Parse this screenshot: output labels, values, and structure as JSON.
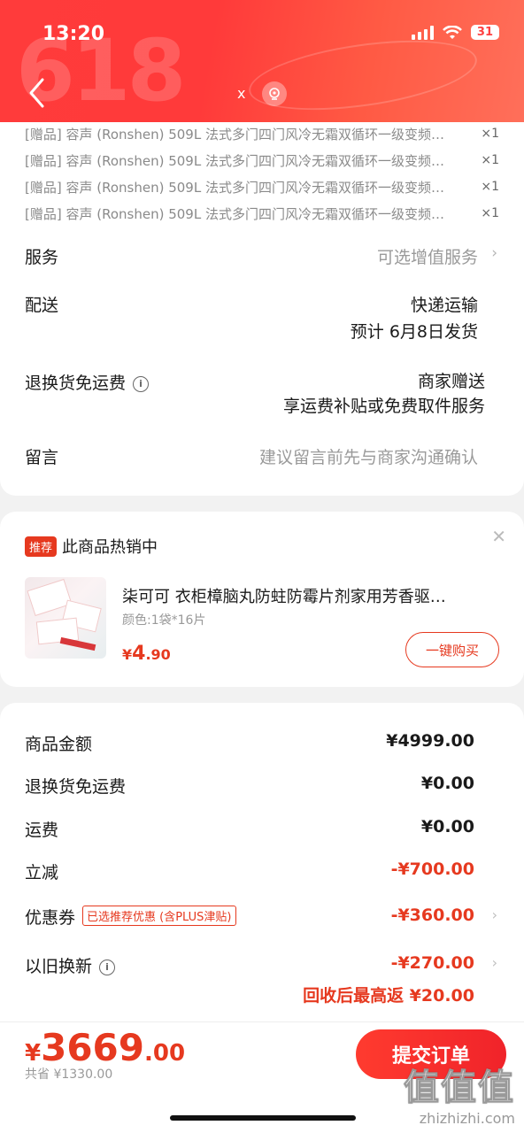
{
  "status_bar": {
    "time": "13:20",
    "battery": "31"
  },
  "header": {
    "banner_text": "618",
    "close_label": "x"
  },
  "gifts": [
    {
      "name": "[赠品] 容声 (Ronshen) 509L 法式多门四门风冷无霜双循环一级变频…",
      "qty": "×1"
    },
    {
      "name": "[赠品] 容声 (Ronshen) 509L 法式多门四门风冷无霜双循环一级变频…",
      "qty": "×1"
    },
    {
      "name": "[赠品] 容声 (Ronshen) 509L 法式多门四门风冷无霜双循环一级变频…",
      "qty": "×1"
    },
    {
      "name": "[赠品] 容声 (Ronshen) 509L 法式多门四门风冷无霜双循环一级变频…",
      "qty": "×1"
    }
  ],
  "service": {
    "label": "服务",
    "value": "可选增值服务"
  },
  "delivery": {
    "label": "配送",
    "method": "快递运输",
    "eta": "预计 6月8日发货"
  },
  "return_shipping": {
    "label": "退换货免运费",
    "line1": "商家赠送",
    "line2": "享运费补贴或免费取件服务"
  },
  "message": {
    "label": "留言",
    "placeholder": "建议留言前先与商家沟通确认"
  },
  "recommend": {
    "badge": "推荐",
    "title": "此商品热销中",
    "product_name": "柒可可 衣柜樟脑丸防蛀防霉片剂家用芳香驱…",
    "spec": "颜色:1袋*16片",
    "price_symbol": "¥",
    "price_int": "4",
    "price_dec": ".90",
    "buy_label": "一键购买"
  },
  "summary": {
    "goods_amount": {
      "label": "商品金额",
      "value": "¥4999.00"
    },
    "return_fee": {
      "label": "退换货免运费",
      "value": "¥0.00"
    },
    "shipping": {
      "label": "运费",
      "value": "¥0.00"
    },
    "discount": {
      "label": "立减",
      "value": "-¥700.00"
    },
    "coupon": {
      "label": "优惠券",
      "tag": "已选推荐优惠 (含PLUS津贴)",
      "value": "-¥360.00"
    },
    "trade_in": {
      "label": "以旧换新",
      "value": "-¥270.00",
      "note": "回收后最高返 ¥20.00"
    }
  },
  "bottom": {
    "total_symbol": "¥",
    "total_int": "3669",
    "total_dec": ".00",
    "saved": "共省 ¥1330.00",
    "submit_label": "提交订单"
  },
  "watermark": {
    "logo": "值值值",
    "url": "zhizhizhi.com"
  },
  "colors": {
    "accent": "#e6391f",
    "header": "#ff3b3b"
  }
}
